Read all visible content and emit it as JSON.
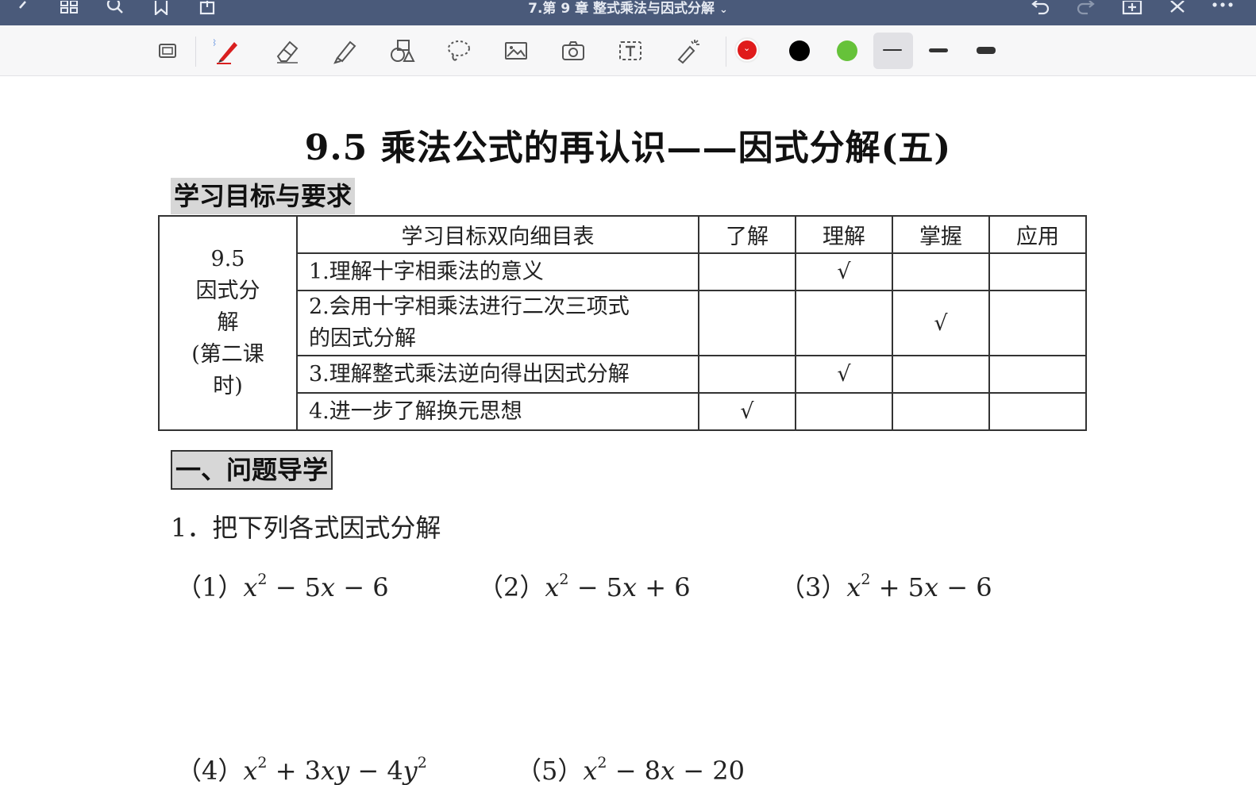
{
  "app": {
    "doc_title": "7.第 9 章 整式乘法与因式分解"
  },
  "toolbar": {
    "pen_color_selected": "#e02020",
    "colors": [
      "#e01b1b",
      "#000000",
      "#66c23a"
    ]
  },
  "document": {
    "title": "9.5  乘法公式的再认识——因式分解(五)",
    "section1": "学习目标与要求",
    "table": {
      "side_label": [
        "9.5",
        "因式分",
        "解",
        "(第二课",
        "时)"
      ],
      "headers": [
        "学习目标双向细目表",
        "了解",
        "理解",
        "掌握",
        "应用"
      ],
      "rows": [
        {
          "text": "1.理解十字相乘法的意义",
          "marks": [
            "",
            "√",
            "",
            ""
          ]
        },
        {
          "text": "2.会用十字相乘法进行二次三项式的因式分解",
          "text_lines": [
            "2.会用十字相乘法进行二次三项式",
            "的因式分解"
          ],
          "marks": [
            "",
            "",
            "√",
            ""
          ]
        },
        {
          "text": "3.理解整式乘法逆向得出因式分解",
          "marks": [
            "",
            "√",
            "",
            ""
          ]
        },
        {
          "text": "4.进一步了解换元思想",
          "marks": [
            "√",
            "",
            "",
            ""
          ]
        }
      ]
    },
    "section2": "一、问题导学",
    "question1": "1．把下列各式因式分解",
    "exprs": [
      {
        "num": "（1）",
        "parts": [
          "x",
          "2",
          " − 5",
          "x",
          " − 6"
        ]
      },
      {
        "num": "（2）",
        "parts": [
          "x",
          "2",
          " − 5",
          "x",
          " + 6"
        ]
      },
      {
        "num": "（3）",
        "parts": [
          "x",
          "2",
          " + 5",
          "x",
          " − 6"
        ]
      },
      {
        "num": "（4）",
        "parts": [
          "x",
          "2",
          " + 3",
          "xy",
          " − 4",
          "y",
          "2"
        ]
      },
      {
        "num": "（5）",
        "parts": [
          "x",
          "2",
          " − 8",
          "x",
          " − 20"
        ]
      }
    ]
  }
}
